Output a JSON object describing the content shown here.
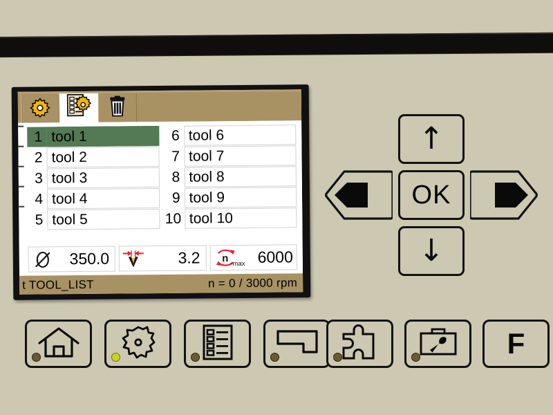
{
  "screen": {
    "tabs": [
      {
        "id": "tab-settings",
        "icon": "gear-icon",
        "label": "Settings",
        "active": false
      },
      {
        "id": "tab-tool-list",
        "icon": "tool-list-icon",
        "label": "Tool list",
        "active": true
      },
      {
        "id": "tab-delete",
        "icon": "trash-icon",
        "label": "Delete",
        "active": false
      }
    ],
    "tool_list": {
      "selected_index": 1,
      "column_left": [
        {
          "number": "1",
          "name": "tool 1"
        },
        {
          "number": "2",
          "name": "tool 2"
        },
        {
          "number": "3",
          "name": "tool 3"
        },
        {
          "number": "4",
          "name": "tool 4"
        },
        {
          "number": "5",
          "name": "tool 5"
        }
      ],
      "column_right": [
        {
          "number": "6",
          "name": "tool 6"
        },
        {
          "number": "7",
          "name": "tool 7"
        },
        {
          "number": "8",
          "name": "tool 8"
        },
        {
          "number": "9",
          "name": "tool 9"
        },
        {
          "number": "10",
          "name": "tool 10"
        }
      ]
    },
    "parameters": [
      {
        "id": "diameter",
        "icon": "diameter-icon",
        "symbol": "⌀",
        "value": "350.0"
      },
      {
        "id": "width",
        "icon": "tool-width-icon",
        "symbol": "",
        "value": "3.2"
      },
      {
        "id": "speed-max",
        "icon": "n-max-icon",
        "symbol": "n-max",
        "value": "6000"
      }
    ],
    "status": {
      "left": "t TOOL_LIST",
      "right": "n = 0 /  3000  rpm"
    },
    "colors": {
      "tab_bar": "#a89264",
      "selection": "#537a54",
      "panel": "#cdc8b2",
      "bezel": "#111113"
    }
  },
  "dpad": {
    "up": {
      "name": "arrow-up-icon",
      "glyph": "↑",
      "label": "Up"
    },
    "down": {
      "name": "arrow-down-icon",
      "glyph": "↓",
      "label": "Down"
    },
    "left": {
      "name": "arrow-left-icon",
      "glyph": "◀",
      "label": "Left"
    },
    "right": {
      "name": "arrow-right-icon",
      "glyph": "▶",
      "label": "Right"
    },
    "ok": {
      "name": "ok-button",
      "label": "OK"
    }
  },
  "function_buttons": {
    "left_group": [
      {
        "id": "home",
        "icon": "house-icon",
        "label": "Home",
        "led": "off"
      },
      {
        "id": "saw",
        "icon": "saw-blade-icon",
        "label": "Saw blade",
        "led": "on"
      },
      {
        "id": "list",
        "icon": "list-icon",
        "label": "List",
        "led": "off"
      },
      {
        "id": "workpiece",
        "icon": "workpiece-icon",
        "label": "Workpiece",
        "led": "off"
      }
    ],
    "right_group": [
      {
        "id": "puzzle",
        "icon": "puzzle-icon",
        "label": "Puzzle",
        "led": "off"
      },
      {
        "id": "toolbox",
        "icon": "toolbox-icon",
        "label": "Toolbox",
        "led": "off"
      },
      {
        "id": "f-key",
        "icon": "",
        "label": "F",
        "led": "none"
      }
    ]
  }
}
